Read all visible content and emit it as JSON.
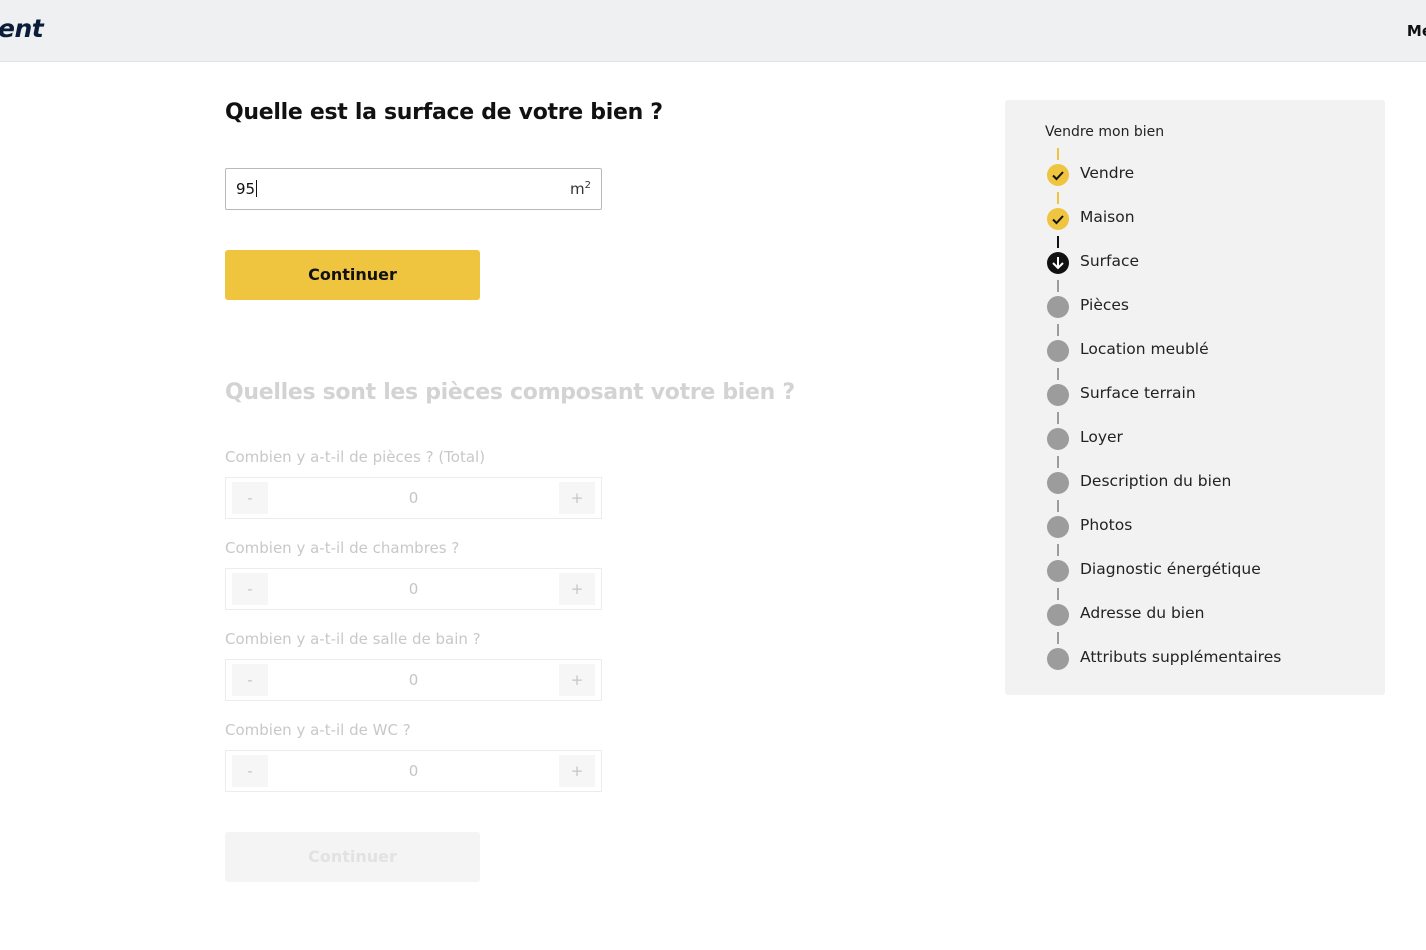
{
  "header": {
    "logo_text": "ent",
    "menu_label": "Me"
  },
  "surface_question": {
    "title": "Quelle est la surface de votre bien ?",
    "value": "95",
    "unit": "m",
    "unit_exponent": "2",
    "continue_label": "Continuer"
  },
  "rooms_question": {
    "title": "Quelles sont les pièces composant votre bien ?",
    "counters": [
      {
        "label": "Combien y a-t-il de pièces ? (Total)",
        "value": "0",
        "minus": "-",
        "plus": "+"
      },
      {
        "label": "Combien y a-t-il de chambres ?",
        "value": "0",
        "minus": "-",
        "plus": "+"
      },
      {
        "label": "Combien y a-t-il de salle de bain ?",
        "value": "0",
        "minus": "-",
        "plus": "+"
      },
      {
        "label": "Combien y a-t-il de WC ?",
        "value": "0",
        "minus": "-",
        "plus": "+"
      }
    ],
    "continue_label": "Continuer"
  },
  "sidebar": {
    "title": "Vendre mon bien",
    "steps": [
      {
        "label": "Vendre",
        "status": "done"
      },
      {
        "label": "Maison",
        "status": "done"
      },
      {
        "label": "Surface",
        "status": "current"
      },
      {
        "label": "Pièces",
        "status": "pending"
      },
      {
        "label": "Location meublé",
        "status": "pending"
      },
      {
        "label": "Surface terrain",
        "status": "pending"
      },
      {
        "label": "Loyer",
        "status": "pending"
      },
      {
        "label": "Description du bien",
        "status": "pending"
      },
      {
        "label": "Photos",
        "status": "pending"
      },
      {
        "label": "Diagnostic énergétique",
        "status": "pending"
      },
      {
        "label": "Adresse du bien",
        "status": "pending"
      },
      {
        "label": "Attributs supplémentaires",
        "status": "pending"
      }
    ]
  },
  "colors": {
    "accent": "#efc43f",
    "current": "#111111",
    "pending": "#9c9c9c",
    "sidebar_bg": "#f2f2f2",
    "header_bg": "#eff0f2"
  }
}
